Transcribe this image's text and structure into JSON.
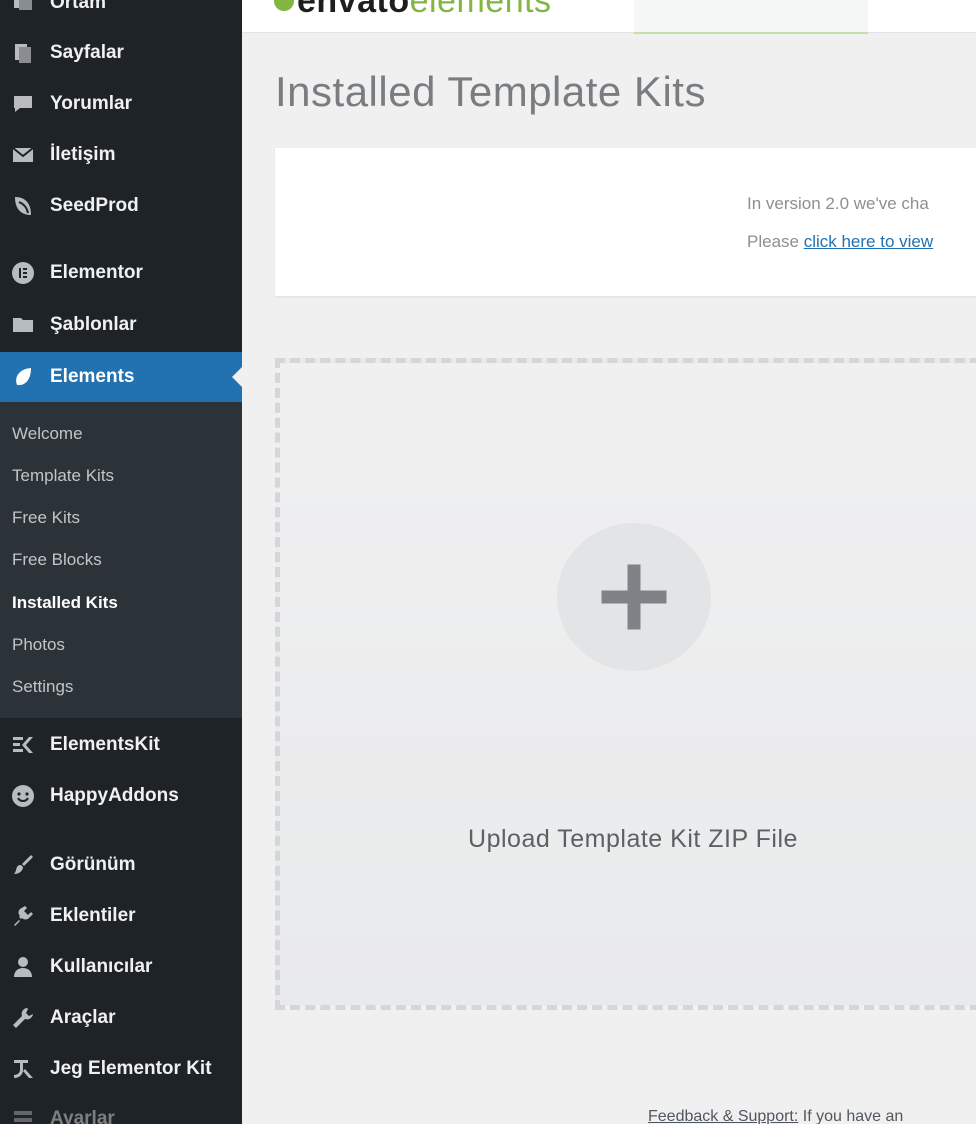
{
  "sidebar": {
    "items": [
      {
        "label": "Ortam",
        "icon": "media-icon"
      },
      {
        "label": "Sayfalar",
        "icon": "pages-icon"
      },
      {
        "label": "Yorumlar",
        "icon": "comments-icon"
      },
      {
        "label": "İletişim",
        "icon": "mail-icon"
      },
      {
        "label": "SeedProd",
        "icon": "seedprod-icon"
      },
      {
        "label": "Elementor",
        "icon": "elementor-icon"
      },
      {
        "label": "Şablonlar",
        "icon": "folder-icon"
      },
      {
        "label": "Elements",
        "icon": "elements-leaf-icon"
      },
      {
        "label": "ElementsKit",
        "icon": "elementskit-icon"
      },
      {
        "label": "HappyAddons",
        "icon": "happy-face-icon"
      },
      {
        "label": "Görünüm",
        "icon": "paintbrush-icon"
      },
      {
        "label": "Eklentiler",
        "icon": "plugin-icon"
      },
      {
        "label": "Kullanıcılar",
        "icon": "user-icon"
      },
      {
        "label": "Araçlar",
        "icon": "wrench-icon"
      },
      {
        "label": "Jeg Elementor Kit",
        "icon": "jeg-icon"
      },
      {
        "label": "Ayarlar",
        "icon": "settings-icon"
      }
    ],
    "submenu": [
      {
        "label": "Welcome"
      },
      {
        "label": "Template Kits"
      },
      {
        "label": "Free Kits"
      },
      {
        "label": "Free Blocks"
      },
      {
        "label": "Installed Kits"
      },
      {
        "label": "Photos"
      },
      {
        "label": "Settings"
      }
    ]
  },
  "header": {
    "logo_part1": "envato",
    "logo_part2": "elements"
  },
  "main": {
    "title": "Installed Template Kits",
    "notice_line1": "In version 2.0 we've cha",
    "notice_line2_prefix": "Please ",
    "notice_link": "click here to view",
    "upload_label": "Upload Template Kit ZIP File",
    "footer_bold": "Feedback & Support:",
    "footer_text": " If you have an"
  },
  "colors": {
    "sidebar_bg": "#1d2327",
    "active_blue": "#2271b1",
    "envato_green": "#82b541"
  }
}
